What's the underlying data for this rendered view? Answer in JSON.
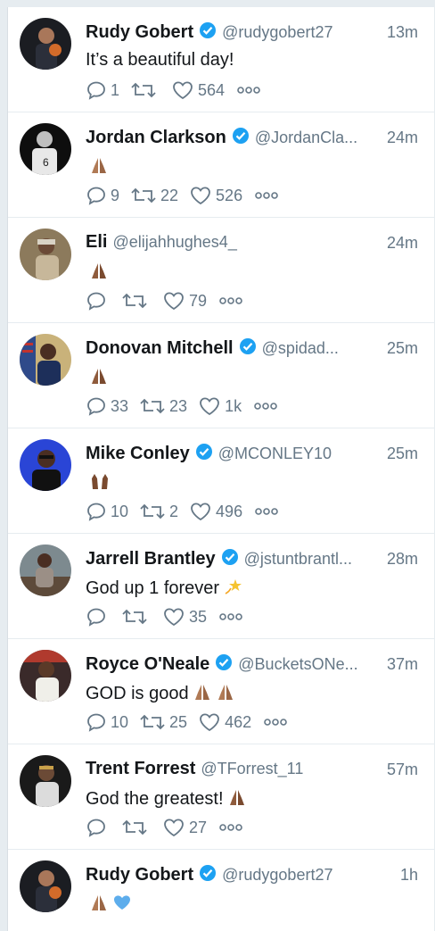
{
  "colors": {
    "background": "#e6ecf0",
    "name": "#14171a",
    "muted": "#657786",
    "verified": "#1da1f2"
  },
  "tweets": [
    {
      "name": "Rudy Gobert",
      "verified": true,
      "handle": "@rudygobert27",
      "time": "13m",
      "text": "It’s a beautiful day!",
      "emoji": [],
      "replies": "1",
      "retweets": "",
      "likes": "564"
    },
    {
      "name": "Jordan Clarkson",
      "verified": true,
      "handle": "@JordanCla...",
      "time": "24m",
      "text": "",
      "emoji": [
        "folded-hands-icon"
      ],
      "replies": "9",
      "retweets": "22",
      "likes": "526"
    },
    {
      "name": "Eli",
      "verified": false,
      "handle": "@elijahhughes4_",
      "time": "24m",
      "text": "",
      "emoji": [
        "folded-hands-icon"
      ],
      "replies": "",
      "retweets": "",
      "likes": "79"
    },
    {
      "name": "Donovan Mitchell",
      "verified": true,
      "handle": "@spidad...",
      "time": "25m",
      "text": "",
      "emoji": [
        "folded-hands-icon"
      ],
      "replies": "33",
      "retweets": "23",
      "likes": "1k"
    },
    {
      "name": "Mike Conley",
      "verified": true,
      "handle": "@MCONLEY10",
      "time": "25m",
      "text": "",
      "emoji": [
        "raised-hands-icon"
      ],
      "replies": "10",
      "retweets": "2",
      "likes": "496"
    },
    {
      "name": "Jarrell Brantley",
      "verified": true,
      "handle": "@jstuntbrantl...",
      "time": "28m",
      "text": "God up 1 forever",
      "emoji": [
        "dizzy-star-icon"
      ],
      "replies": "",
      "retweets": "",
      "likes": "35"
    },
    {
      "name": "Royce O'Neale",
      "verified": true,
      "handle": "@BucketsONe...",
      "time": "37m",
      "text": "GOD is good",
      "emoji": [
        "folded-hands-icon",
        "folded-hands-icon"
      ],
      "replies": "10",
      "retweets": "25",
      "likes": "462"
    },
    {
      "name": "Trent Forrest",
      "verified": false,
      "handle": "@TForrest_11",
      "time": "57m",
      "text": "God the greatest!",
      "emoji": [
        "folded-hands-icon"
      ],
      "replies": "",
      "retweets": "",
      "likes": "27"
    },
    {
      "name": "Rudy Gobert",
      "verified": true,
      "handle": "@rudygobert27",
      "time": "1h",
      "text": "",
      "emoji": [
        "folded-hands-icon",
        "blue-heart-icon"
      ],
      "replies": "",
      "retweets": "",
      "likes": ""
    }
  ]
}
